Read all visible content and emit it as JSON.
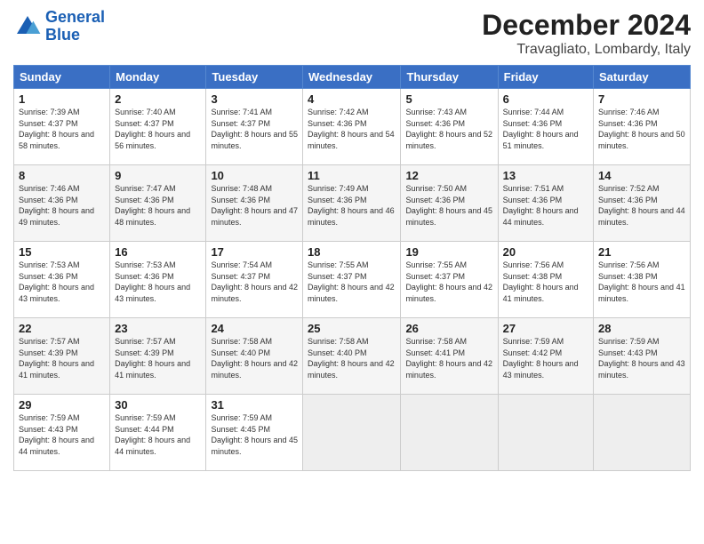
{
  "header": {
    "logo_general": "General",
    "logo_blue": "Blue",
    "month": "December 2024",
    "location": "Travagliato, Lombardy, Italy"
  },
  "days_of_week": [
    "Sunday",
    "Monday",
    "Tuesday",
    "Wednesday",
    "Thursday",
    "Friday",
    "Saturday"
  ],
  "weeks": [
    [
      {
        "day": "1",
        "sunrise": "7:39 AM",
        "sunset": "4:37 PM",
        "daylight": "8 hours and 58 minutes."
      },
      {
        "day": "2",
        "sunrise": "7:40 AM",
        "sunset": "4:37 PM",
        "daylight": "8 hours and 56 minutes."
      },
      {
        "day": "3",
        "sunrise": "7:41 AM",
        "sunset": "4:37 PM",
        "daylight": "8 hours and 55 minutes."
      },
      {
        "day": "4",
        "sunrise": "7:42 AM",
        "sunset": "4:36 PM",
        "daylight": "8 hours and 54 minutes."
      },
      {
        "day": "5",
        "sunrise": "7:43 AM",
        "sunset": "4:36 PM",
        "daylight": "8 hours and 52 minutes."
      },
      {
        "day": "6",
        "sunrise": "7:44 AM",
        "sunset": "4:36 PM",
        "daylight": "8 hours and 51 minutes."
      },
      {
        "day": "7",
        "sunrise": "7:46 AM",
        "sunset": "4:36 PM",
        "daylight": "8 hours and 50 minutes."
      }
    ],
    [
      {
        "day": "8",
        "sunrise": "7:46 AM",
        "sunset": "4:36 PM",
        "daylight": "8 hours and 49 minutes."
      },
      {
        "day": "9",
        "sunrise": "7:47 AM",
        "sunset": "4:36 PM",
        "daylight": "8 hours and 48 minutes."
      },
      {
        "day": "10",
        "sunrise": "7:48 AM",
        "sunset": "4:36 PM",
        "daylight": "8 hours and 47 minutes."
      },
      {
        "day": "11",
        "sunrise": "7:49 AM",
        "sunset": "4:36 PM",
        "daylight": "8 hours and 46 minutes."
      },
      {
        "day": "12",
        "sunrise": "7:50 AM",
        "sunset": "4:36 PM",
        "daylight": "8 hours and 45 minutes."
      },
      {
        "day": "13",
        "sunrise": "7:51 AM",
        "sunset": "4:36 PM",
        "daylight": "8 hours and 44 minutes."
      },
      {
        "day": "14",
        "sunrise": "7:52 AM",
        "sunset": "4:36 PM",
        "daylight": "8 hours and 44 minutes."
      }
    ],
    [
      {
        "day": "15",
        "sunrise": "7:53 AM",
        "sunset": "4:36 PM",
        "daylight": "8 hours and 43 minutes."
      },
      {
        "day": "16",
        "sunrise": "7:53 AM",
        "sunset": "4:36 PM",
        "daylight": "8 hours and 43 minutes."
      },
      {
        "day": "17",
        "sunrise": "7:54 AM",
        "sunset": "4:37 PM",
        "daylight": "8 hours and 42 minutes."
      },
      {
        "day": "18",
        "sunrise": "7:55 AM",
        "sunset": "4:37 PM",
        "daylight": "8 hours and 42 minutes."
      },
      {
        "day": "19",
        "sunrise": "7:55 AM",
        "sunset": "4:37 PM",
        "daylight": "8 hours and 42 minutes."
      },
      {
        "day": "20",
        "sunrise": "7:56 AM",
        "sunset": "4:38 PM",
        "daylight": "8 hours and 41 minutes."
      },
      {
        "day": "21",
        "sunrise": "7:56 AM",
        "sunset": "4:38 PM",
        "daylight": "8 hours and 41 minutes."
      }
    ],
    [
      {
        "day": "22",
        "sunrise": "7:57 AM",
        "sunset": "4:39 PM",
        "daylight": "8 hours and 41 minutes."
      },
      {
        "day": "23",
        "sunrise": "7:57 AM",
        "sunset": "4:39 PM",
        "daylight": "8 hours and 41 minutes."
      },
      {
        "day": "24",
        "sunrise": "7:58 AM",
        "sunset": "4:40 PM",
        "daylight": "8 hours and 42 minutes."
      },
      {
        "day": "25",
        "sunrise": "7:58 AM",
        "sunset": "4:40 PM",
        "daylight": "8 hours and 42 minutes."
      },
      {
        "day": "26",
        "sunrise": "7:58 AM",
        "sunset": "4:41 PM",
        "daylight": "8 hours and 42 minutes."
      },
      {
        "day": "27",
        "sunrise": "7:59 AM",
        "sunset": "4:42 PM",
        "daylight": "8 hours and 43 minutes."
      },
      {
        "day": "28",
        "sunrise": "7:59 AM",
        "sunset": "4:43 PM",
        "daylight": "8 hours and 43 minutes."
      }
    ],
    [
      {
        "day": "29",
        "sunrise": "7:59 AM",
        "sunset": "4:43 PM",
        "daylight": "8 hours and 44 minutes."
      },
      {
        "day": "30",
        "sunrise": "7:59 AM",
        "sunset": "4:44 PM",
        "daylight": "8 hours and 44 minutes."
      },
      {
        "day": "31",
        "sunrise": "7:59 AM",
        "sunset": "4:45 PM",
        "daylight": "8 hours and 45 minutes."
      },
      null,
      null,
      null,
      null
    ]
  ]
}
